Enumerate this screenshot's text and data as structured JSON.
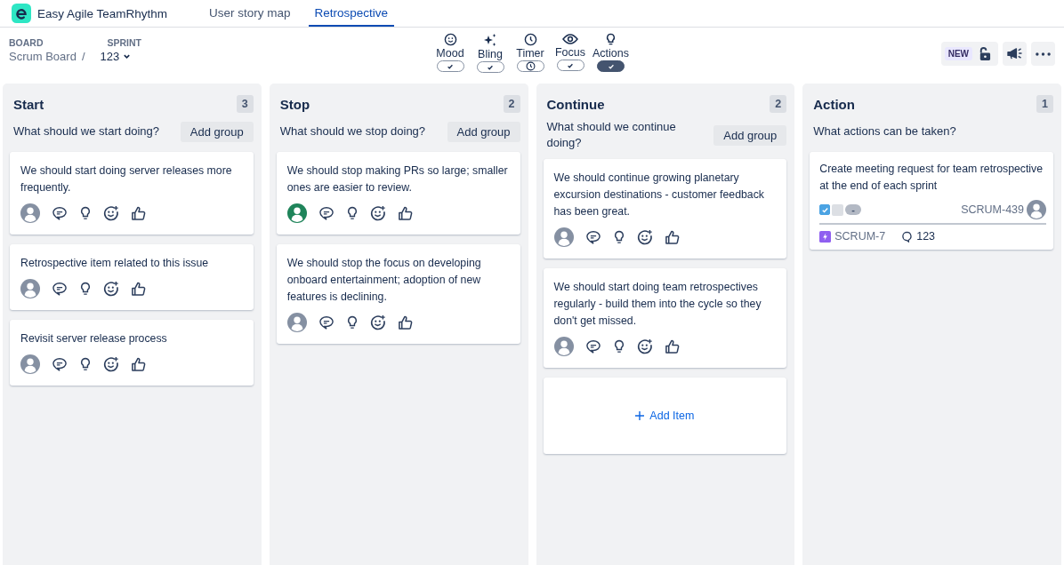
{
  "app": {
    "name": "Easy Agile TeamRhythm"
  },
  "tabs": [
    {
      "label": "User story map",
      "selected": false
    },
    {
      "label": "Retrospective",
      "selected": true
    }
  ],
  "board": {
    "label": "BOARD",
    "value": "Scrum Board",
    "separator": "/"
  },
  "sprint": {
    "label": "SPRINT",
    "value": "123"
  },
  "tools": [
    {
      "label": "Mood",
      "kind": "check",
      "selected": false
    },
    {
      "label": "Bling",
      "kind": "check",
      "selected": false
    },
    {
      "label": "Timer",
      "kind": "clock",
      "selected": false
    },
    {
      "label": "Focus",
      "kind": "check",
      "selected": false
    },
    {
      "label": "Actions",
      "kind": "check",
      "selected": true
    }
  ],
  "new_badge": "NEW",
  "columns": [
    {
      "title": "Start",
      "count": "3",
      "prompt": "What should we start doing?",
      "add_group": "Add group",
      "cards": [
        {
          "text": "We should start doing server releases more frequently.",
          "color": "#8590a2"
        },
        {
          "text": "Retrospective item related to this issue",
          "color": "#8590a2"
        },
        {
          "text": "Revisit server release process",
          "color": "#8590a2"
        }
      ]
    },
    {
      "title": "Stop",
      "count": "2",
      "prompt": "What should we stop doing?",
      "add_group": "Add group",
      "cards": [
        {
          "text": "We should stop making PRs so large; smaller ones are easier to review.",
          "color": "#1f845a"
        },
        {
          "text": "We should stop the focus on developing onboard entertainment; adoption of new features is declining.",
          "color": "#8590a2"
        }
      ]
    },
    {
      "title": "Continue",
      "count": "2",
      "prompt": "What should we continue doing?",
      "add_group": "Add group",
      "cards": [
        {
          "text": "We should continue growing planetary excursion destinations - customer feedback has been great.",
          "color": "#8590a2"
        },
        {
          "text": "We should start doing team retrospectives regularly - build them into the cycle so they don't get missed.",
          "color": "#8590a2"
        }
      ],
      "add_item": "Add Item"
    },
    {
      "title": "Action",
      "count": "1",
      "prompt": "What actions can be taken?",
      "actions": [
        {
          "text": "Create meeting request for team retrospective at the end of each sprint",
          "checked": true,
          "status": "-",
          "key": "SCRUM-439",
          "epic": "SCRUM-7",
          "comments": "123"
        }
      ]
    }
  ]
}
